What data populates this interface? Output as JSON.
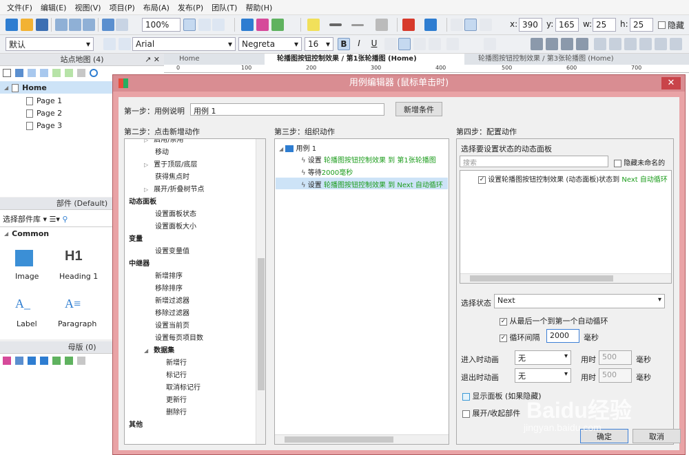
{
  "menu": [
    "文件(F)",
    "编辑(E)",
    "视图(V)",
    "项目(P)",
    "布局(A)",
    "发布(P)",
    "团队(T)",
    "帮助(H)"
  ],
  "toolbar": {
    "zoom": "100%",
    "x_label": "x:",
    "x_value": "390",
    "y_label": "y:",
    "y_value": "165",
    "w_label": "w:",
    "w_value": "25",
    "h_label": "h:",
    "h_value": "25",
    "hidden_label": "隐藏",
    "style": "默认",
    "font": "Arial",
    "weight": "Negreta",
    "size": "16",
    "bold": "B",
    "italic": "I",
    "underline": "U"
  },
  "sitemap": {
    "title": "站点地图 (4)",
    "home": "Home",
    "pages": [
      "Page 1",
      "Page 2",
      "Page 3"
    ]
  },
  "widgets": {
    "title": "部件 (Default)",
    "library_label": "选择部件库",
    "group": "Common",
    "items": [
      {
        "icon": "image-icon",
        "label": "Image"
      },
      {
        "icon": "heading-icon",
        "glyph": "H1",
        "label": "Heading 1"
      },
      {
        "icon": "label-icon",
        "glyph": "A_",
        "label": "Label"
      },
      {
        "icon": "paragraph-icon",
        "glyph": "A≡",
        "label": "Paragraph"
      }
    ]
  },
  "masters": {
    "title": "母版 (0)"
  },
  "tabs": [
    "Home",
    "轮播图按钮控制效果 / 第1张轮播图 (Home)",
    "轮播图按钮控制效果 / 第3张轮播图 (Home)"
  ],
  "ruler": [
    "0",
    "100",
    "200",
    "300",
    "400",
    "500",
    "600",
    "700"
  ],
  "dialog": {
    "title": "用例编辑器 (鼠标单击时)",
    "close": "✕",
    "step1_label": "第一步：用例说明",
    "step1_value": "用例 1",
    "add_condition": "新增条件",
    "step2_label": "第二步：点击新增动作",
    "step3_label": "第三步：组织动作",
    "step4_label": "第四步：配置动作",
    "actions": [
      {
        "text": "启用/禁用",
        "indent": 2,
        "arrow": true
      },
      {
        "text": "移动",
        "indent": 2
      },
      {
        "text": "置于顶层/底层",
        "indent": 2,
        "arrow": true
      },
      {
        "text": "获得焦点时",
        "indent": 2
      },
      {
        "text": "展开/折叠树节点",
        "indent": 2,
        "arrow": true
      },
      {
        "text": "动态面板",
        "indent": 1,
        "bold": true
      },
      {
        "text": "设置面板状态",
        "indent": 2
      },
      {
        "text": "设置面板大小",
        "indent": 2
      },
      {
        "text": "变量",
        "indent": 1,
        "bold": true
      },
      {
        "text": "设置变量值",
        "indent": 2
      },
      {
        "text": "中继器",
        "indent": 1,
        "bold": true
      },
      {
        "text": "新增排序",
        "indent": 2
      },
      {
        "text": "移除排序",
        "indent": 2
      },
      {
        "text": "新增过滤器",
        "indent": 2
      },
      {
        "text": "移除过滤器",
        "indent": 2
      },
      {
        "text": "设置当前页",
        "indent": 2
      },
      {
        "text": "设置每页项目数",
        "indent": 2
      },
      {
        "text": "数据集",
        "indent": 2,
        "bold": true
      },
      {
        "text": "新增行",
        "indent": 3
      },
      {
        "text": "标记行",
        "indent": 3
      },
      {
        "text": "取消标记行",
        "indent": 3
      },
      {
        "text": "更新行",
        "indent": 3
      },
      {
        "text": "删除行",
        "indent": 3
      },
      {
        "text": "其他",
        "indent": 1,
        "bold": true
      }
    ],
    "case_name": "用例 1",
    "organized": [
      {
        "prefix": "设置 ",
        "green": "轮播图按钮控制效果 到 第1张轮播图"
      },
      {
        "prefix": "等待",
        "green": "2000毫秒"
      },
      {
        "prefix": "设置 ",
        "green": "轮播图按钮控制效果 到 Next 自动循环"
      }
    ],
    "panel_select_label": "选择要设置状态的动态面板",
    "search_placeholder": "搜索",
    "hide_unnamed": "隐藏未命名的",
    "panel_item_prefix": "设置轮播图按钮控制效果 (动态面板)状态到 ",
    "panel_item_green": "Next 自动循环",
    "select_state_label": "选择状态",
    "select_state_value": "Next",
    "loop_last_first": "从最后一个到第一个自动循环",
    "loop_interval_label": "循环间隔",
    "loop_interval_value": "2000",
    "ms": "毫秒",
    "enter_anim_label": "进入时动画",
    "exit_anim_label": "退出时动画",
    "anim_value": "无",
    "time_label": "用时",
    "time_value": "500",
    "show_panel": "显示面板 (如果隐藏)",
    "expand_collapse": "展开/收起部件",
    "ok": "确定",
    "cancel": "取消"
  },
  "watermark": {
    "brand": "Baidu经验",
    "url": "jingyan.baidu.com"
  }
}
